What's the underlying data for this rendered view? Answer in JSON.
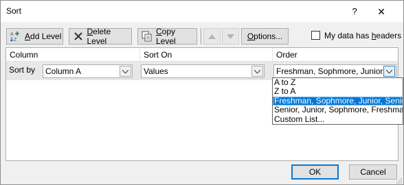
{
  "window": {
    "title": "Sort",
    "help_label": "?",
    "close_label": "✕"
  },
  "toolbar": {
    "add_level_mnemonic": "A",
    "add_level_rest": "dd Level",
    "delete_level_mnemonic": "D",
    "delete_level_rest": "elete Level",
    "copy_level_mnemonic": "C",
    "copy_level_rest": "opy Level",
    "options_mnemonic": "O",
    "options_rest": "ptions...",
    "my_data_has_headers_prefix": "My data has ",
    "my_data_has_headers_mnemonic": "h",
    "my_data_has_headers_suffix": "eaders",
    "my_data_has_headers_checked": false
  },
  "grid": {
    "headers": [
      "Column",
      "Sort On",
      "Order"
    ],
    "row": {
      "label": "Sort by",
      "column": "Column A",
      "sort_on": "Values",
      "order": "Freshman, Sophmore, Junior, S"
    }
  },
  "order_dropdown": {
    "options": [
      "A to Z",
      "Z to A",
      "Freshman, Sophmore, Junior, Senior",
      "Senior, Junior, Sophmore, Freshman",
      "Custom List..."
    ],
    "selected_index": 2
  },
  "footer": {
    "ok_label": "OK",
    "cancel_label": "Cancel"
  },
  "colors": {
    "accent": "#0078d7",
    "dialog_bg": "#f0f0f0",
    "selected_row_bg": "#e8e8e8"
  }
}
